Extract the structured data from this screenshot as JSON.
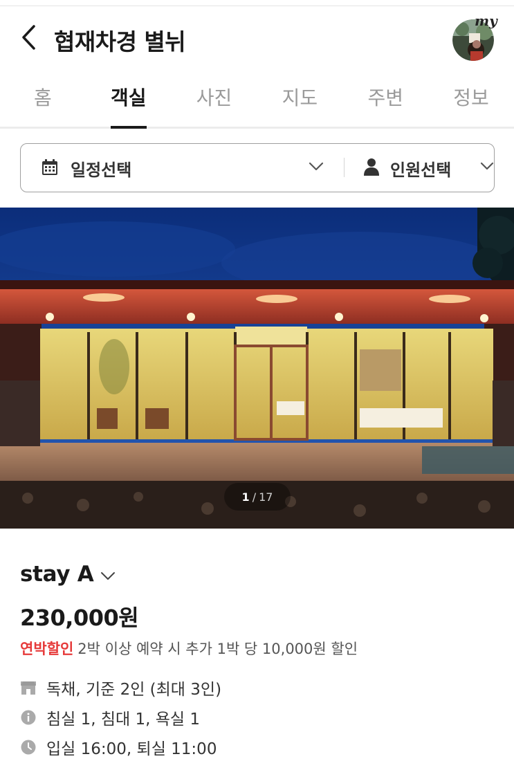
{
  "header": {
    "title": "협재차경 별뉘",
    "my_label": "my"
  },
  "tabs": [
    {
      "label": "홈",
      "active": false
    },
    {
      "label": "객실",
      "active": true
    },
    {
      "label": "사진",
      "active": false
    },
    {
      "label": "지도",
      "active": false
    },
    {
      "label": "주변",
      "active": false
    },
    {
      "label": "정보",
      "active": false
    }
  ],
  "filters": {
    "date_label": "일정선택",
    "guest_label": "인원선택"
  },
  "gallery": {
    "current": "1",
    "separator": "/",
    "total": "17"
  },
  "room": {
    "name": "stay A",
    "price": "230,000원",
    "promo_tag": "연박할인",
    "promo_text": "2박 이상 예약 시 추가 1박 당 10,000원 할인",
    "info": [
      {
        "icon": "building-icon",
        "text": "독채, 기준 2인 (최대 3인)"
      },
      {
        "icon": "info-icon",
        "text": "침실 1, 침대 1, 욕실 1"
      },
      {
        "icon": "clock-icon",
        "text": "입실 16:00, 퇴실 11:00"
      }
    ]
  },
  "colors": {
    "accent_red": "#e63a3a",
    "text_dark": "#1a1a1a",
    "text_muted": "#9a9a9a"
  }
}
